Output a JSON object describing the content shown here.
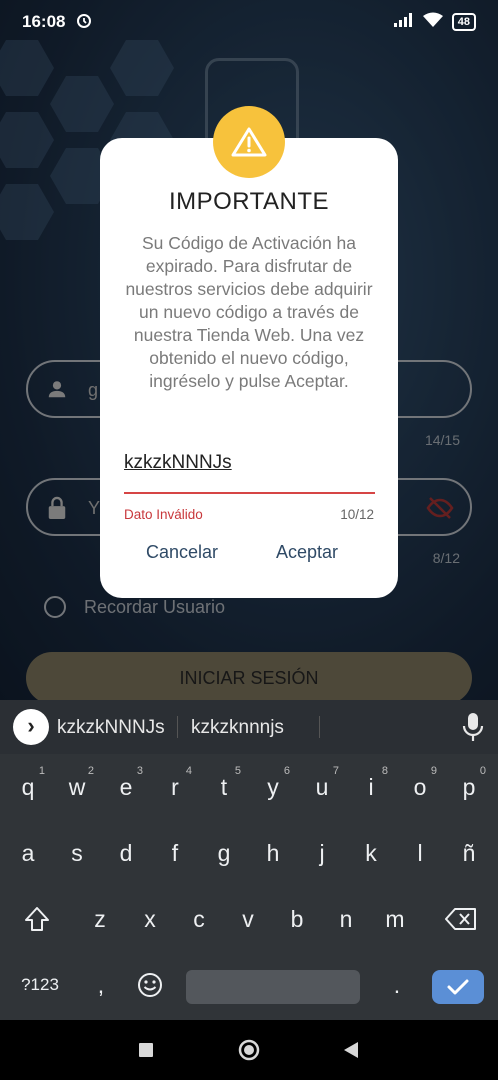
{
  "status_bar": {
    "time": "16:08",
    "battery": "48"
  },
  "login": {
    "username_value": "g",
    "username_counter": "14/15",
    "password_value": "Y",
    "password_counter": "8/12",
    "remember_label": "Recordar Usuario",
    "login_button": "INICIAR SESIÓN"
  },
  "dialog": {
    "title": "IMPORTANTE",
    "message": "Su Código de Activación ha expirado. Para disfrutar de nuestros servicios debe adquirir un nuevo código a través de nuestra Tienda Web. Una vez obtenido el nuevo código, ingréselo y pulse Aceptar.",
    "input_value": "kzkzkNNNJs",
    "error_text": "Dato Inválido",
    "char_counter": "10/12",
    "cancel_label": "Cancelar",
    "accept_label": "Aceptar",
    "accent_color": "#f7c23c",
    "error_color": "#c8383c"
  },
  "keyboard": {
    "suggestions": [
      "kzkzkNNNJs",
      "kzkzknnnjs"
    ],
    "row1": [
      "q",
      "w",
      "e",
      "r",
      "t",
      "y",
      "u",
      "i",
      "o",
      "p"
    ],
    "row1_hints": [
      "1",
      "2",
      "3",
      "4",
      "5",
      "6",
      "7",
      "8",
      "9",
      "0"
    ],
    "row2": [
      "a",
      "s",
      "d",
      "f",
      "g",
      "h",
      "j",
      "k",
      "l",
      "ñ"
    ],
    "row3": [
      "z",
      "x",
      "c",
      "v",
      "b",
      "n",
      "m"
    ],
    "symbols_key": "?123",
    "comma_key": ",",
    "period_key": "."
  }
}
